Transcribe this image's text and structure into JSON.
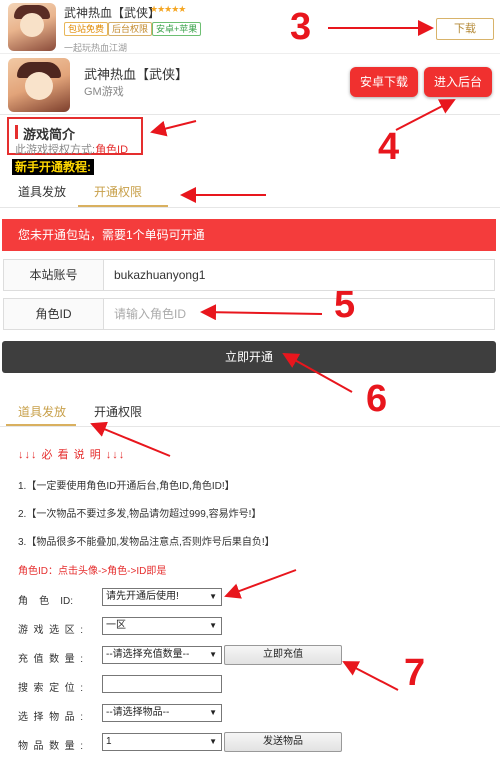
{
  "banner": {
    "title": "武神热血【武侠】",
    "stars": "★★★★★",
    "tags": [
      "包站免费",
      "后台权限",
      "安卓+苹果"
    ],
    "subtitle": "一起玩热血江湖",
    "download_label": "下载"
  },
  "game": {
    "title": "武神热血【武侠】",
    "subtitle": "GM游戏",
    "android_download_label": "安卓下载",
    "enter_backend_label": "进入后台"
  },
  "intro": {
    "title": "游戏简介",
    "auth_prefix": "此游戏授权方式:",
    "auth_value": "角色ID"
  },
  "newbie_label": "新手开通教程:",
  "tabs_top": [
    "道具发放",
    "开通权限"
  ],
  "alert_text": "您未开通包站，需要1个单码可开通",
  "form": {
    "account_label": "本站账号",
    "account_value": "bukazhuanyong1",
    "role_label": "角色ID",
    "role_placeholder": "请输入角色ID",
    "submit_label": "立即开通"
  },
  "tabs_bottom": [
    "道具发放",
    "开通权限"
  ],
  "notes": {
    "title": "↓↓↓ 必 看 说 明 ↓↓↓",
    "lines": [
      "1.【一定要使用角色ID开通后台,角色ID,角色ID!】",
      "2.【一次物品不要过多发,物品请勿超过999,容易炸号!】",
      "3.【物品很多不能叠加,发物品注意点,否则炸号后果自负!】"
    ],
    "role_hint": "角色ID：点击头像->角色->ID即是"
  },
  "gm": {
    "role_label": "角    色    ID:",
    "role_value": "请先开通后使用!",
    "server_label": "游  戏  选  区  :",
    "server_value": "一区",
    "recharge_label": "充  值  数  量  :",
    "recharge_value": "--请选择充值数量--",
    "recharge_button": "立即充值",
    "search_label": "搜  索  定  位  :",
    "item_label": "选  择  物  品  :",
    "item_value": "--请选择物品--",
    "qty_label": "物  品  数  量  :",
    "qty_value": "1",
    "send_button": "发送物品"
  },
  "annotations": [
    "3",
    "4",
    "5",
    "6",
    "7"
  ],
  "colors": {
    "accent_red": "#f0302f",
    "gold": "#d9b05f",
    "annotation_red": "#e8161d"
  }
}
